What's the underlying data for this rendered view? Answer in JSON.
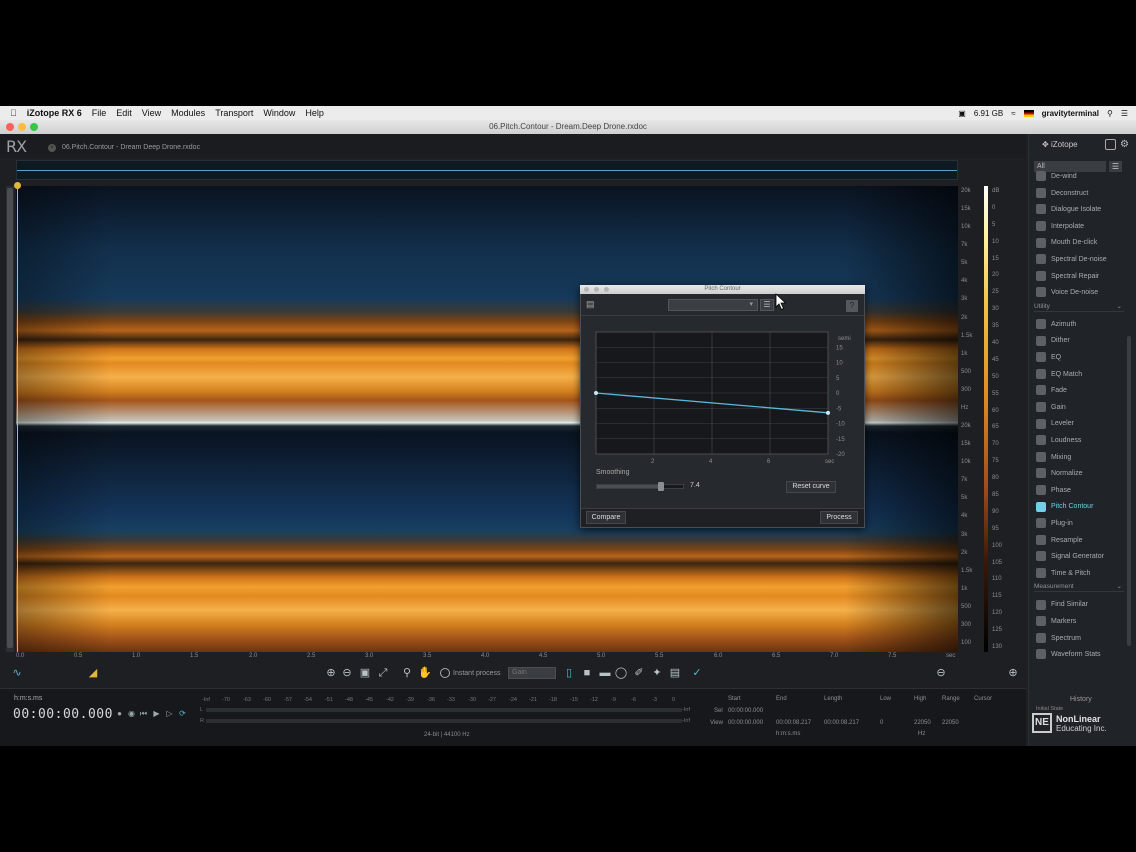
{
  "menubar": {
    "app_name": "iZotope RX 6",
    "items": [
      "File",
      "Edit",
      "View",
      "Modules",
      "Transport",
      "Window",
      "Help"
    ],
    "memory": "6.91 GB",
    "user": "gravityterminal"
  },
  "window": {
    "title": "06.Pitch.Contour - Dream.Deep Drone.rxdoc"
  },
  "app": {
    "logo": "RX",
    "file_tab": "06.Pitch.Contour - Dream Deep Drone.rxdoc"
  },
  "freq_scale": [
    "20k",
    "15k",
    "10k",
    "7k",
    "5k",
    "4k",
    "3k",
    "2k",
    "1.5k",
    "1k",
    "500",
    "300",
    "Hz",
    "20k",
    "15k",
    "10k",
    "7k",
    "5k",
    "4k",
    "3k",
    "2k",
    "1.5k",
    "1k",
    "500",
    "300",
    "100"
  ],
  "db_scale": [
    "dB",
    "0",
    "5",
    "10",
    "15",
    "20",
    "25",
    "30",
    "35",
    "40",
    "45",
    "50",
    "55",
    "60",
    "65",
    "70",
    "75",
    "80",
    "85",
    "90",
    "95",
    "100",
    "105",
    "110",
    "115",
    "120",
    "125",
    "130"
  ],
  "time_ruler": [
    "0.0",
    "0.5",
    "1.0",
    "1.5",
    "2.0",
    "2.5",
    "3.0",
    "3.5",
    "4.0",
    "4.5",
    "5.0",
    "5.5",
    "6.0",
    "6.5",
    "7.0",
    "7.5",
    "sec"
  ],
  "toolbar": {
    "instant_process": "Instant process",
    "gain_select": "Gain"
  },
  "transport": {
    "time_format": "h:m:s.ms",
    "timecode": "00:00:00.000",
    "bit_info": "24-bit | 44100 Hz"
  },
  "meter": {
    "scale": [
      "-Inf",
      "-70",
      "-63",
      "-60",
      "-57",
      "-54",
      "-51",
      "-48",
      "-45",
      "-42",
      "-39",
      "-36",
      "-33",
      "-30",
      "-27",
      "-24",
      "-21",
      "-18",
      "-15",
      "-12",
      "-9",
      "-6",
      "-3",
      "0"
    ],
    "peak_l": "-Inf",
    "peak_r": "-Inf",
    "ch_l": "L",
    "ch_r": "R"
  },
  "selection": {
    "headers": [
      "Start",
      "End",
      "Length",
      "Low",
      "High",
      "Range",
      "Cursor"
    ],
    "sel_label": "Sel",
    "view_label": "View",
    "sel_start": "00:00:00.000",
    "view_start": "00:00:00.000",
    "view_end": "00:00:08.217",
    "view_length": "00:00:08.217",
    "view_low": "0",
    "view_high": "22050",
    "view_range": "22050",
    "unit_time": "h:m:s.ms",
    "unit_hz": "Hz"
  },
  "panel": {
    "brand": "iZotope",
    "filter": "All",
    "modules_repair": [
      {
        "label": "De-wind"
      },
      {
        "label": "Deconstruct"
      },
      {
        "label": "Dialogue Isolate"
      },
      {
        "label": "Interpolate"
      },
      {
        "label": "Mouth De-click"
      },
      {
        "label": "Spectral De-noise"
      },
      {
        "label": "Spectral Repair"
      },
      {
        "label": "Voice De-noise"
      }
    ],
    "section_utility": "Utility",
    "modules_utility": [
      {
        "label": "Azimuth"
      },
      {
        "label": "Dither"
      },
      {
        "label": "EQ"
      },
      {
        "label": "EQ Match"
      },
      {
        "label": "Fade"
      },
      {
        "label": "Gain"
      },
      {
        "label": "Leveler"
      },
      {
        "label": "Loudness"
      },
      {
        "label": "Mixing"
      },
      {
        "label": "Normalize"
      },
      {
        "label": "Phase"
      },
      {
        "label": "Pitch Contour"
      },
      {
        "label": "Plug-in"
      },
      {
        "label": "Resample"
      },
      {
        "label": "Signal Generator"
      },
      {
        "label": "Time & Pitch"
      }
    ],
    "section_measurement": "Measurement",
    "modules_measurement": [
      {
        "label": "Find Similar"
      },
      {
        "label": "Markers"
      },
      {
        "label": "Spectrum"
      },
      {
        "label": "Waveform Stats"
      }
    ],
    "history": "History",
    "initial_state": "Initial State"
  },
  "watermark": {
    "line1": "NonLinear",
    "line2": "Educating Inc."
  },
  "pitch_contour": {
    "title": "Pitch Contour",
    "smoothing_label": "Smoothing",
    "smoothing_value": "7.4",
    "smoothing_fraction": 0.74,
    "reset_curve": "Reset curve",
    "compare": "Compare",
    "process": "Process",
    "y_unit": "semi",
    "y_ticks": [
      "15",
      "10",
      "5",
      "0",
      "-5",
      "-10",
      "-15",
      "-20"
    ],
    "x_ticks": [
      "2",
      "4",
      "6",
      "sec"
    ],
    "curve": {
      "start_semitones": 0,
      "end_semitones": -6.5
    }
  }
}
